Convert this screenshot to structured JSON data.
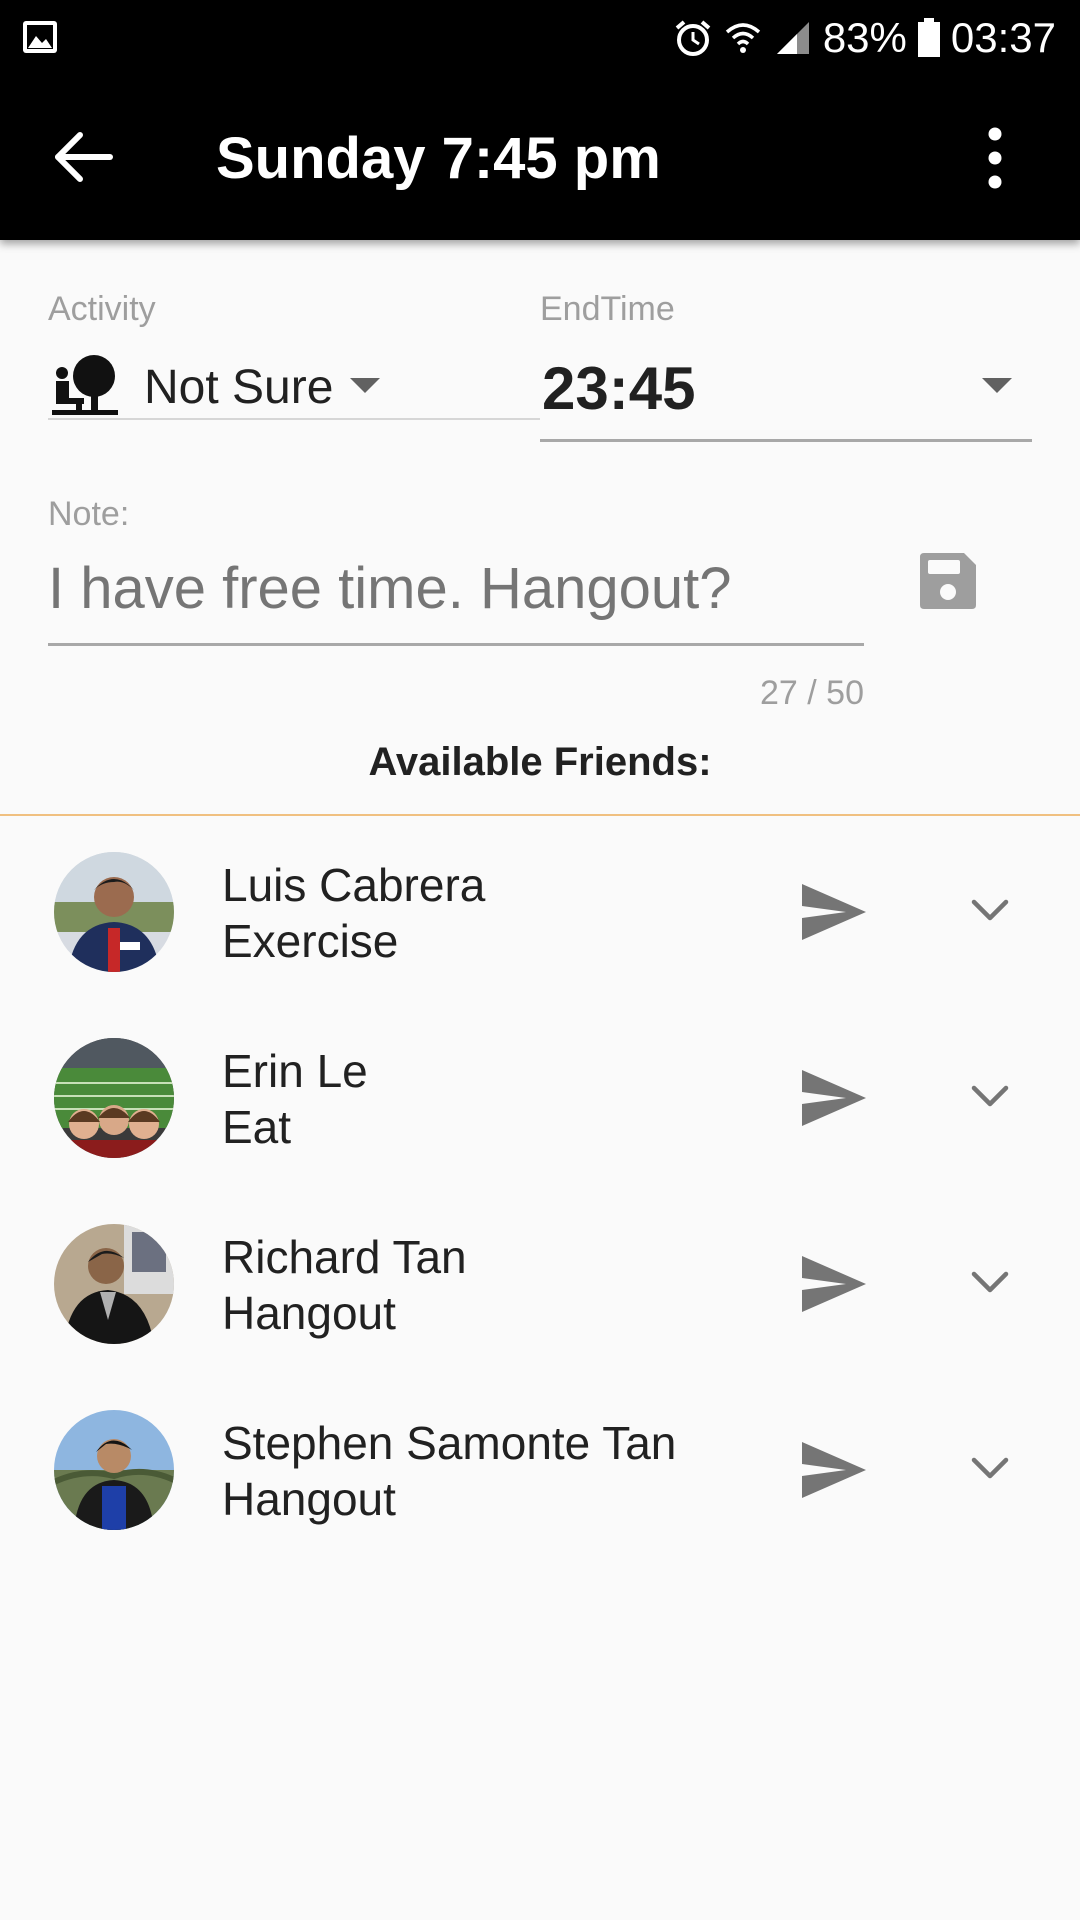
{
  "status_bar": {
    "battery": "83%",
    "time": "03:37",
    "icons": [
      "image-icon",
      "alarm-icon",
      "wifi-icon",
      "signal-icon",
      "battery-icon"
    ]
  },
  "app_bar": {
    "title": "Sunday 7:45 pm",
    "back_icon": "arrow-back-icon",
    "menu_icon": "more-vert-icon"
  },
  "form": {
    "activity_label": "Activity",
    "activity_value": "Not Sure",
    "activity_icon": "person-tree-icon",
    "endtime_label": "EndTime",
    "endtime_value": "23:45",
    "note_label": "Note:",
    "note_value": "I have free time. Hangout?",
    "note_counter": "27 / 50",
    "save_icon": "save-icon"
  },
  "friends_section": {
    "title": "Available Friends:",
    "items": [
      {
        "name": "Luis Cabrera",
        "activity": "Exercise"
      },
      {
        "name": "Erin Le",
        "activity": "Eat"
      },
      {
        "name": "Richard Tan",
        "activity": "Hangout"
      },
      {
        "name": "Stephen Samonte Tan",
        "activity": "Hangout"
      }
    ]
  },
  "colors": {
    "app_bar_bg": "#000000",
    "background": "#fafafa",
    "divider_accent": "#f0c080",
    "icon_gray": "#757575"
  }
}
